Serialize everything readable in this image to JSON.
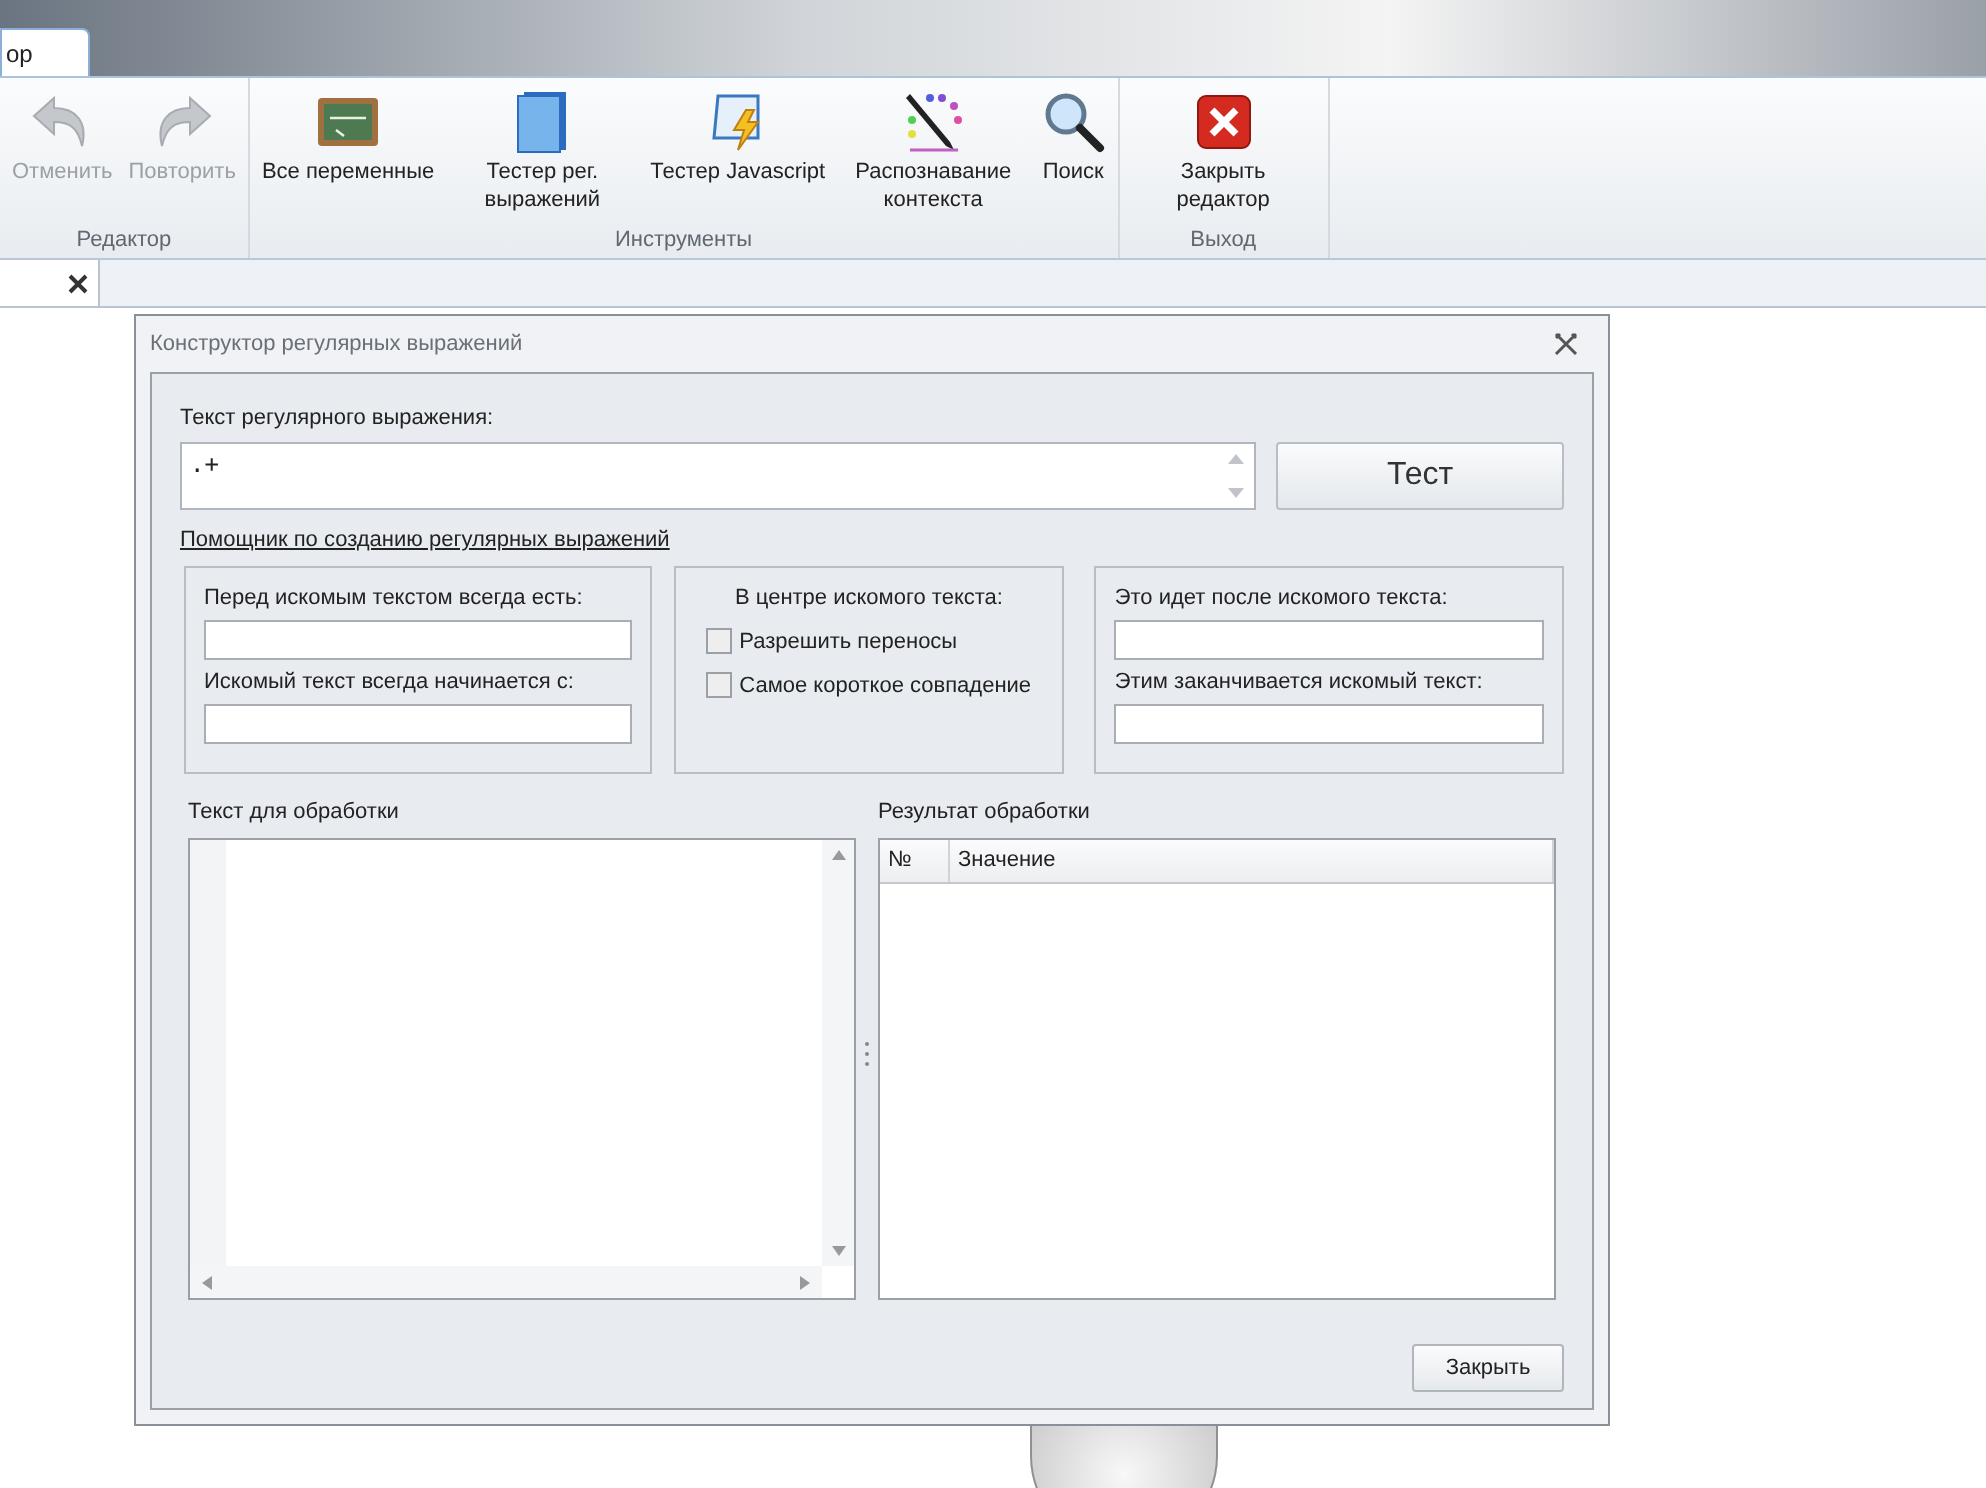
{
  "tab_strip": {
    "tabs": [
      {
        "label": "ор",
        "selected": true
      }
    ]
  },
  "ribbon": {
    "groups": [
      {
        "label": "Редактор",
        "buttons": [
          {
            "label": "Отменить",
            "disabled": true
          },
          {
            "label": "Повторить",
            "disabled": true
          }
        ]
      },
      {
        "label": "Инструменты",
        "buttons": [
          {
            "label": "Все переменные",
            "disabled": false
          },
          {
            "label": "Тестер рег. выражений",
            "disabled": false
          },
          {
            "label": "Тестер Javascript",
            "disabled": false
          },
          {
            "label": "Распознавание контекста",
            "disabled": false
          },
          {
            "label": "Поиск",
            "disabled": false
          }
        ]
      },
      {
        "label": "Выход",
        "buttons": [
          {
            "label": "Закрыть редактор",
            "disabled": false
          }
        ]
      }
    ]
  },
  "dialog": {
    "title": "Конструктор регулярных выражений",
    "regex_label": "Текст регулярного выражения:",
    "regex_value": ".+",
    "test_button": "Тест",
    "helper_link": "Помощник по созданию регулярных выражений",
    "before_group": {
      "fields": [
        {
          "label": "Перед искомым текстом всегда есть:"
        },
        {
          "label": "Искомый текст всегда начинается с:"
        }
      ]
    },
    "center_group": {
      "title": "В центре искомого текста:",
      "checkboxes": [
        {
          "label": "Разрешить переносы",
          "checked": false
        },
        {
          "label": "Самое короткое совпадение",
          "checked": false
        }
      ]
    },
    "after_group": {
      "fields": [
        {
          "label": "Это идет после искомого текста:"
        },
        {
          "label": "Этим заканчивается искомый текст:"
        }
      ]
    },
    "input_label": "Текст для обработки",
    "result_label": "Результат обработки",
    "result_table": {
      "columns": [
        "№",
        "Значение"
      ]
    },
    "close_button": "Закрыть"
  }
}
